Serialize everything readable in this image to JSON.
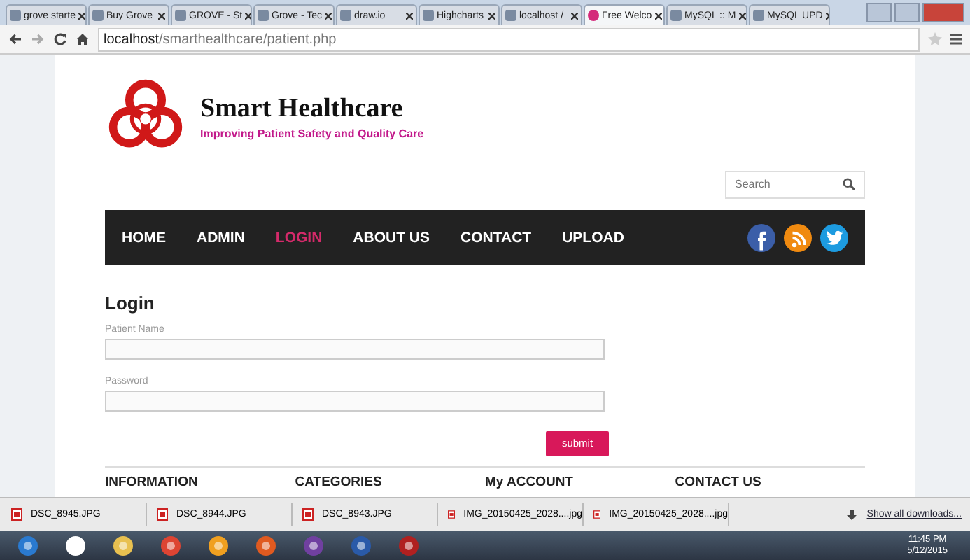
{
  "browser": {
    "tabs": [
      {
        "title": "grove starte",
        "selected": false
      },
      {
        "title": "Buy Grove",
        "selected": false
      },
      {
        "title": "GROVE - St",
        "selected": false
      },
      {
        "title": "Grove - Tec",
        "selected": false
      },
      {
        "title": "draw.io",
        "selected": false
      },
      {
        "title": "Highcharts",
        "selected": false
      },
      {
        "title": "localhost / ",
        "selected": false
      },
      {
        "title": "Free Welco",
        "selected": true
      },
      {
        "title": "MySQL :: M",
        "selected": false
      },
      {
        "title": "MySQL UPD",
        "selected": false
      }
    ],
    "address": {
      "host": "localhost",
      "path": "/smarthealthcare/patient.php"
    }
  },
  "site": {
    "title": "Smart Healthcare",
    "tagline": "Improving Patient Safety and Quality Care",
    "search": {
      "placeholder": "Search"
    },
    "nav": [
      {
        "label": "HOME",
        "selected": false
      },
      {
        "label": "ADMIN",
        "selected": false
      },
      {
        "label": "LOGIN",
        "selected": true
      },
      {
        "label": "ABOUT US",
        "selected": false
      },
      {
        "label": "CONTACT",
        "selected": false
      },
      {
        "label": "UPLOAD",
        "selected": false
      }
    ],
    "social": [
      {
        "kind": "facebook",
        "color": "#3b5ea8"
      },
      {
        "kind": "rss",
        "color": "#f08a10"
      },
      {
        "kind": "twitter",
        "color": "#1d9be0"
      }
    ]
  },
  "login": {
    "heading": "Login",
    "fields": [
      {
        "label": "Patient Name"
      },
      {
        "label": "Password"
      }
    ],
    "submit": "submit"
  },
  "footer": {
    "headings": [
      "INFORMATION",
      "CATEGORIES",
      "My ACCOUNT",
      "CONTACT US"
    ]
  },
  "downloads": {
    "items": [
      "DSC_8945.JPG",
      "DSC_8944.JPG",
      "DSC_8943.JPG",
      "IMG_20150425_2028....jpg",
      "IMG_20150425_2028....jpg"
    ],
    "show_all": "Show all downloads..."
  },
  "taskbar": {
    "time": "11:45 PM",
    "date": "5/12/2015"
  }
}
